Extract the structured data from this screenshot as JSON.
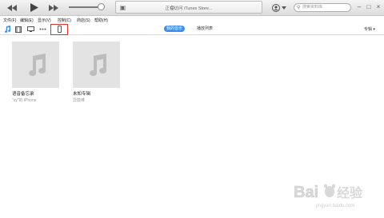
{
  "player": {
    "lcd_text": "正在访问 iTunes Store...",
    "search_placeholder": "搜索资料库"
  },
  "menu": [
    "文件(F)",
    "编辑(E)",
    "显示(V)",
    "控制(C)",
    "商店(S)",
    "帮助(H)"
  ],
  "nav": {
    "tabs": [
      "我的音乐",
      "播放列表"
    ],
    "sort_label": "专辑 ▾"
  },
  "albums": [
    {
      "title": "语音备忘录",
      "subtitle": "\"sy\"的 iPhone"
    },
    {
      "title": "未知专辑",
      "subtitle": "异鼓棒"
    }
  ],
  "watermark": {
    "text": "Bai du 经验",
    "url": "jingyan.baidu.com"
  },
  "colors": {
    "accent": "#3e8ee8",
    "highlight_box": "#d9322e",
    "art_bg": "#e3e3e3"
  }
}
